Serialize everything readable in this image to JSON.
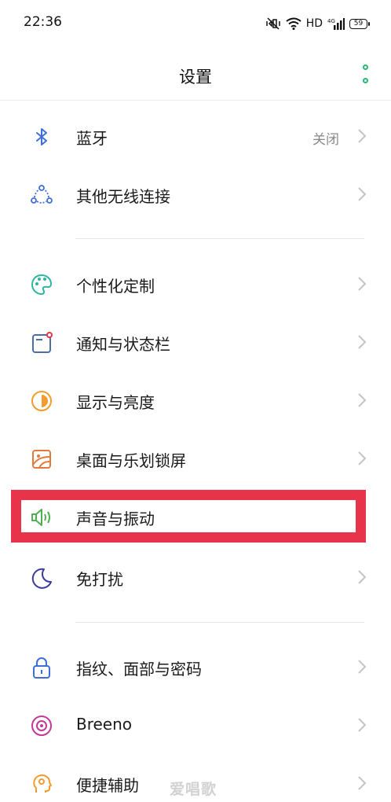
{
  "status_bar": {
    "time": "22:36",
    "network": "HD",
    "signal": "4G",
    "battery": "59"
  },
  "header": {
    "title": "设置"
  },
  "sections": [
    {
      "items": [
        {
          "label": "蓝牙",
          "value": "关闭",
          "icon": "bluetooth-icon"
        },
        {
          "label": "其他无线连接",
          "icon": "connection-icon"
        }
      ]
    },
    {
      "items": [
        {
          "label": "个性化定制",
          "icon": "palette-icon"
        },
        {
          "label": "通知与状态栏",
          "icon": "notification-icon"
        },
        {
          "label": "显示与亮度",
          "icon": "brightness-icon"
        },
        {
          "label": "桌面与乐划锁屏",
          "icon": "wallpaper-icon"
        },
        {
          "label": "声音与振动",
          "icon": "speaker-icon"
        },
        {
          "label": "免打扰",
          "icon": "moon-icon"
        }
      ]
    },
    {
      "items": [
        {
          "label": "指纹、面部与密码",
          "icon": "lock-icon"
        },
        {
          "label": "Breeno",
          "icon": "breeno-icon"
        },
        {
          "label": "便捷辅助",
          "icon": "head-icon"
        }
      ]
    }
  ],
  "watermark": "爱唱歌",
  "colors": {
    "accent_green": "#2bb673",
    "highlight_red": "#e8344a"
  }
}
